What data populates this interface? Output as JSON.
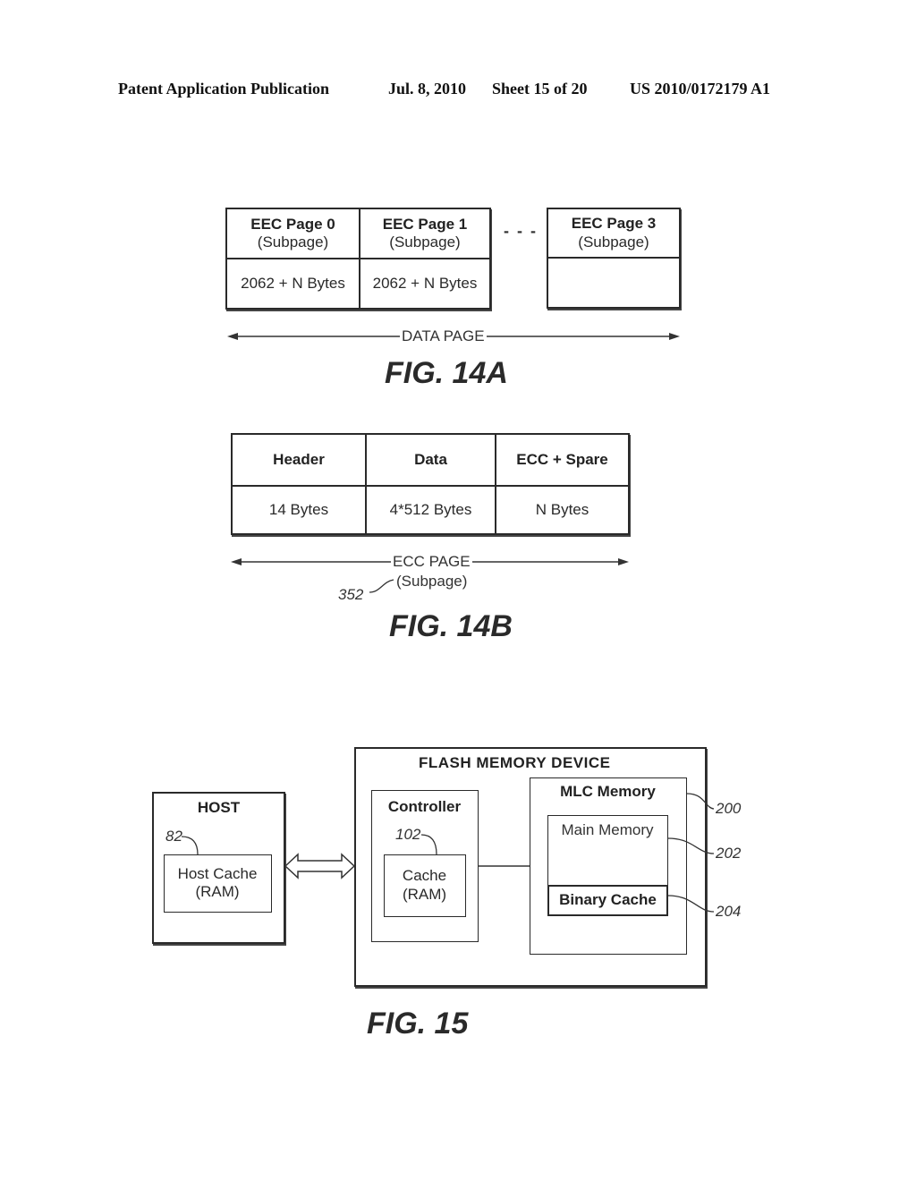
{
  "header": {
    "publication": "Patent Application Publication",
    "date": "Jul. 8, 2010",
    "sheet": "Sheet 15 of 20",
    "number": "US 2010/0172179 A1"
  },
  "fig14a": {
    "pages": [
      {
        "title": "EEC Page 0",
        "subtitle": "(Subpage)",
        "size": "2062 + N Bytes"
      },
      {
        "title": "EEC Page 1",
        "subtitle": "(Subpage)",
        "size": "2062 + N Bytes"
      },
      {
        "title": "EEC Page 3",
        "subtitle": "(Subpage)",
        "size": ""
      }
    ],
    "ellipsis": "- - -",
    "span_label": "DATA PAGE",
    "caption": "FIG. 14A"
  },
  "fig14b": {
    "columns": [
      {
        "title": "Header",
        "size": "14 Bytes"
      },
      {
        "title": "Data",
        "size": "4*512 Bytes"
      },
      {
        "title": "ECC + Spare",
        "size": "N Bytes"
      }
    ],
    "span_label": "ECC PAGE",
    "span_sublabel": "(Subpage)",
    "ref": "352",
    "caption": "FIG. 14B"
  },
  "fig15": {
    "host": {
      "title": "HOST",
      "cache": "Host Cache",
      "cache_sub": "(RAM)",
      "ref": "82"
    },
    "device": {
      "title": "FLASH MEMORY DEVICE"
    },
    "controller": {
      "title": "Controller",
      "cache": "Cache",
      "cache_sub": "(RAM)",
      "ref": "102"
    },
    "mlc": {
      "title": "MLC Memory",
      "ref": "200"
    },
    "main_memory": {
      "title": "Main Memory",
      "ref": "202"
    },
    "binary_cache": {
      "title": "Binary Cache",
      "ref": "204"
    },
    "caption": "FIG. 15"
  }
}
